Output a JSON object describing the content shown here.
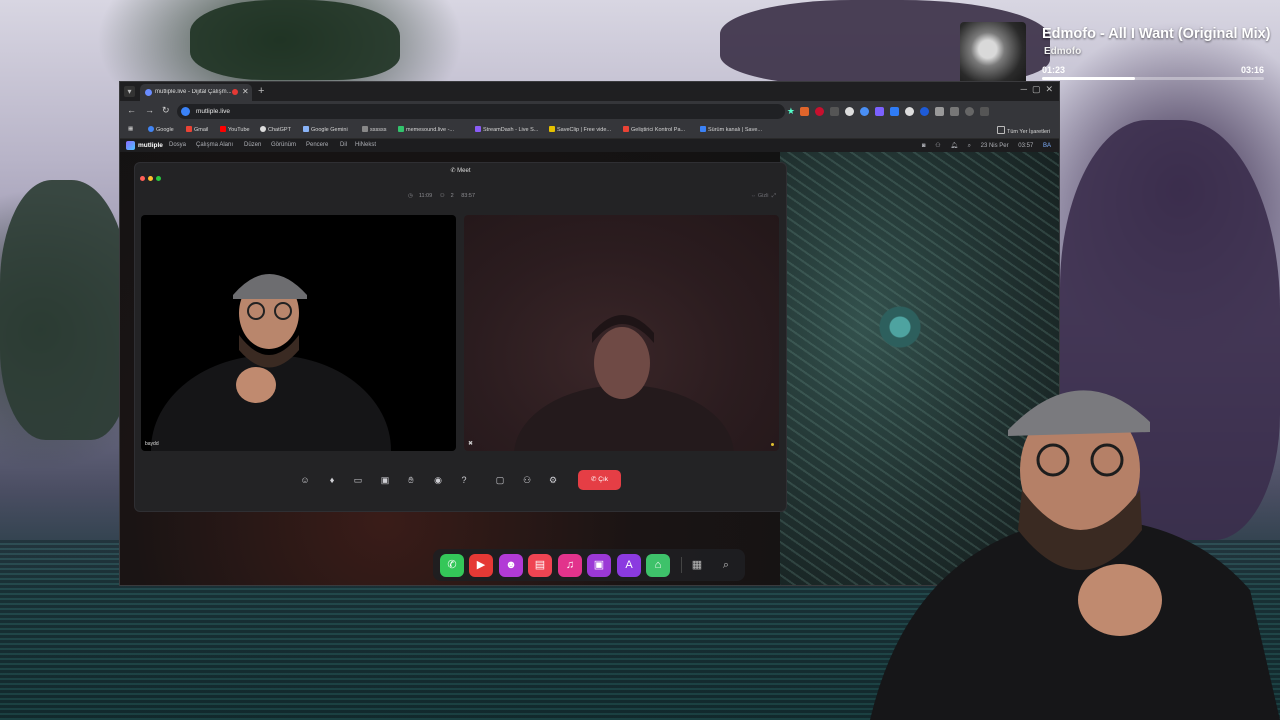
{
  "music": {
    "title": "Edmofo - All I Want (Original Mix)",
    "artist": "Edmofo",
    "current_time": "01:23",
    "duration": "03:16",
    "progress": 0.42
  },
  "browser": {
    "tab_title": "mutliple.live - Dijital Çalışm...",
    "url": "mutliple.live",
    "bookmarks": [
      "Google",
      "Gmail",
      "YouTube",
      "ChatGPT",
      "Google Gemini",
      "ssssss",
      "memesound.live -...",
      "StreamDash - Live S...",
      "SaveClip | Free vide...",
      "Geliştirici Kontrol Pa...",
      "Sürüm kanalı | Save..."
    ],
    "bookmarks_all": "Tüm Yer İşaretleri"
  },
  "app": {
    "brand": "mutliple",
    "menu": [
      "Dosya",
      "Çalışma Alanı",
      "Düzen",
      "Görünüm",
      "Pencere",
      "Dil",
      "HiNekst"
    ],
    "date": "23 Nis Per",
    "time": "03:57",
    "user_initials": "BA"
  },
  "meet": {
    "title": "Meet",
    "info_time": "11:09",
    "info_participants": "2",
    "info_duration": "83:57",
    "top_right": "Gizli",
    "participant_left": "baydd",
    "leave_label": "Çık"
  },
  "colors": {
    "leave": "#e53e45",
    "dock": [
      "#34c759",
      "#e53935",
      "#b23ad6",
      "#ef4452",
      "#e2338c",
      "#9b38d6",
      "#8b3ae0",
      "#3ec26a"
    ]
  },
  "icons": {
    "controls": [
      "emoji-icon",
      "microphone-icon",
      "camera-icon",
      "screen-share-icon",
      "hand-raise-icon",
      "broadcast-icon",
      "hearing-icon",
      "chat-icon",
      "participants-icon",
      "settings-icon"
    ],
    "dock": [
      "phone-icon",
      "video-icon",
      "robot-icon",
      "calendar-icon",
      "music-icon",
      "presentation-icon",
      "translate-icon",
      "inbox-icon",
      "grid-icon",
      "search-icon"
    ]
  }
}
